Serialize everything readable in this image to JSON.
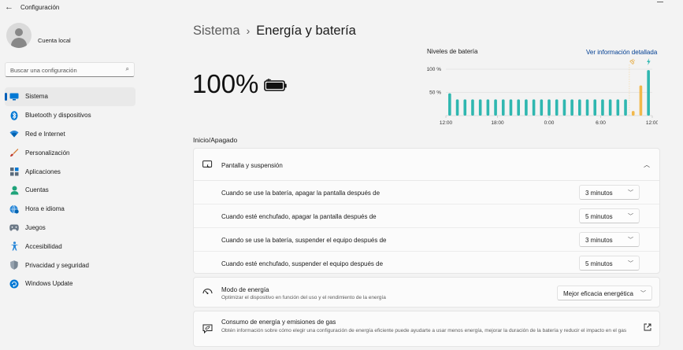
{
  "window": {
    "title": "Configuración"
  },
  "account": {
    "name": "Cuenta local"
  },
  "search": {
    "placeholder": "Buscar una configuración"
  },
  "sidebar": {
    "items": [
      {
        "label": "Sistema",
        "icon": "monitor-icon",
        "active": true
      },
      {
        "label": "Bluetooth y dispositivos",
        "icon": "bluetooth-icon"
      },
      {
        "label": "Red e Internet",
        "icon": "wifi-icon"
      },
      {
        "label": "Personalización",
        "icon": "brush-icon"
      },
      {
        "label": "Aplicaciones",
        "icon": "apps-icon"
      },
      {
        "label": "Cuentas",
        "icon": "person-icon"
      },
      {
        "label": "Hora e idioma",
        "icon": "globe-clock-icon"
      },
      {
        "label": "Juegos",
        "icon": "gamepad-icon"
      },
      {
        "label": "Accesibilidad",
        "icon": "accessibility-icon"
      },
      {
        "label": "Privacidad y seguridad",
        "icon": "shield-icon"
      },
      {
        "label": "Windows Update",
        "icon": "update-icon"
      }
    ]
  },
  "breadcrumb": {
    "parent": "Sistema",
    "separator": "›",
    "current": "Energía y batería"
  },
  "battery": {
    "percent_text": "100%",
    "level": 1.0
  },
  "chart_data": {
    "type": "bar",
    "title": "Niveles de batería",
    "link": "Ver información detallada",
    "y_ticks": [
      "100 %",
      "50 %"
    ],
    "x_ticks": [
      "12:00",
      "18:00",
      "0:00",
      "6:00",
      "12:00"
    ],
    "ylim": [
      0,
      100
    ],
    "values": [
      48,
      35,
      35,
      35,
      35,
      35,
      35,
      35,
      35,
      35,
      35,
      35,
      35,
      35,
      35,
      35,
      35,
      35,
      35,
      35,
      35,
      35,
      35,
      35,
      10,
      65,
      98
    ],
    "bar_states": [
      "discharge",
      "discharge",
      "discharge",
      "discharge",
      "discharge",
      "discharge",
      "discharge",
      "discharge",
      "discharge",
      "discharge",
      "discharge",
      "discharge",
      "discharge",
      "discharge",
      "discharge",
      "discharge",
      "discharge",
      "discharge",
      "discharge",
      "discharge",
      "discharge",
      "discharge",
      "discharge",
      "discharge",
      "plugged",
      "plugged",
      "charging"
    ],
    "colors": {
      "discharge": "#2fb7b0",
      "plugged": "#f2b84b",
      "charging": "#2fb7b0"
    }
  },
  "section": {
    "title": "Inicio/Apagado"
  },
  "screen_sleep": {
    "title": "Pantalla y suspensión",
    "rows": [
      {
        "label": "Cuando se use la batería, apagar la pantalla después de",
        "value": "3 minutos"
      },
      {
        "label": "Cuando esté enchufado, apagar la pantalla después de",
        "value": "5 minutos"
      },
      {
        "label": "Cuando se use la batería, suspender el equipo después de",
        "value": "3 minutos"
      },
      {
        "label": "Cuando esté enchufado, suspender el equipo después de",
        "value": "5 minutos"
      }
    ]
  },
  "power_mode": {
    "title": "Modo de energía",
    "description": "Optimizar el dispositivo en función del uso y el rendimiento de la energía",
    "value": "Mejor eficacia energética"
  },
  "emissions": {
    "title": "Consumo de energía y emisiones de gas",
    "description": "Obtén información sobre cómo elegir una configuración de energía eficiente puede ayudarte a usar menos energía, mejorar la duración de la batería y reducir el impacto en el gas"
  }
}
